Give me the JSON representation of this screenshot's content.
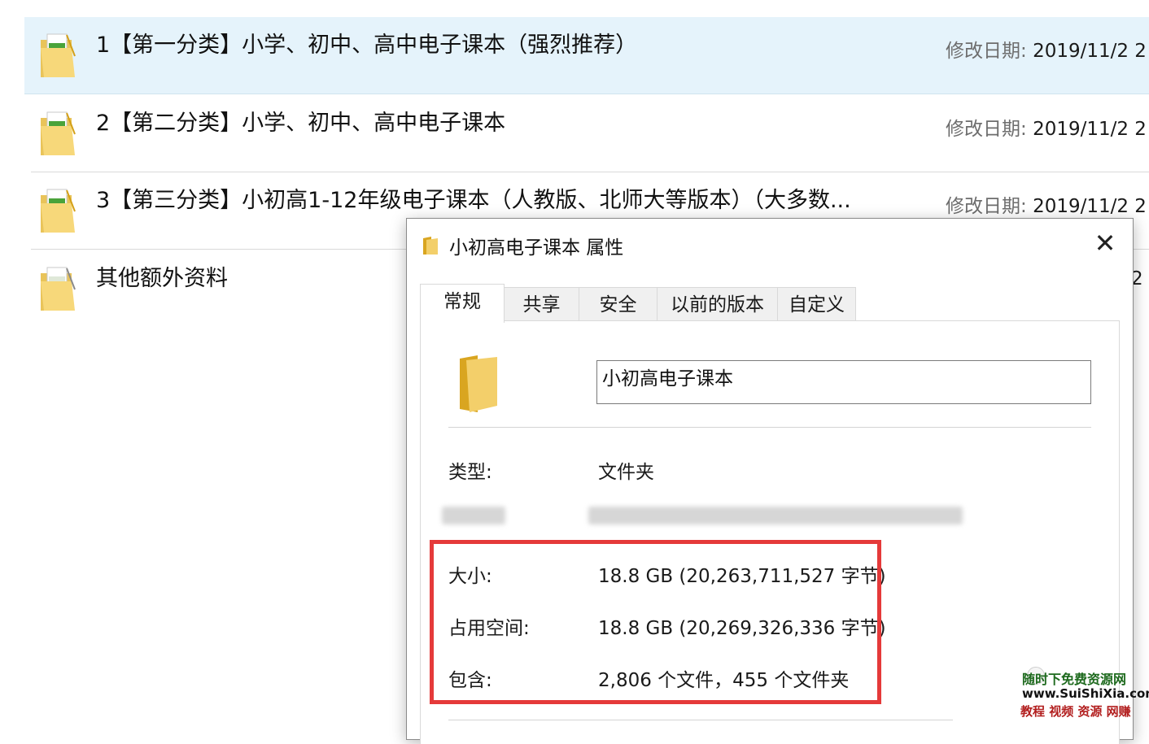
{
  "file_list": {
    "date_label": "修改日期:",
    "items": [
      {
        "name": "1【第一分类】小学、初中、高中电子课本（强烈推荐）",
        "date": "2019/11/2 2",
        "selected": true
      },
      {
        "name": "2【第二分类】小学、初中、高中电子课本",
        "date": "2019/11/2 2",
        "selected": false
      },
      {
        "name": "3【第三分类】小初高1-12年级电子课本（人教版、北师大等版本）（大多数...",
        "date": "2019/11/2 2",
        "selected": false
      },
      {
        "name": "其他额外资料",
        "date": "2",
        "selected": false
      }
    ],
    "icon": "folder-with-documents-icon"
  },
  "dialog": {
    "title": "小初高电子课本 属性",
    "close_glyph": "✕",
    "tabs": [
      {
        "label": "常规",
        "active": true
      },
      {
        "label": "共享",
        "active": false
      },
      {
        "label": "安全",
        "active": false
      },
      {
        "label": "以前的版本",
        "active": false
      },
      {
        "label": "自定义",
        "active": false
      }
    ],
    "folder_name_value": "小初高电子课本",
    "properties": {
      "type_label": "类型:",
      "type_value": "文件夹",
      "size_label": "大小:",
      "size_value": "18.8 GB (20,263,711,527 字节)",
      "disk_label": "占用空间:",
      "disk_value": "18.8 GB (20,269,326,336 字节)",
      "contains_label": "包含:",
      "contains_value": "2,806 个文件，455 个文件夹"
    },
    "highlight_color": "#e53a3a"
  },
  "watermark": {
    "line1": "随时下免费资源网",
    "line2": "www.SuiShiXia.com",
    "line3": "教程 视频 资源 网赚"
  },
  "colors": {
    "selection_bg": "#e5f3fb",
    "folder_yellow": "#f3cf6a",
    "accent_red": "#e53a3a"
  }
}
